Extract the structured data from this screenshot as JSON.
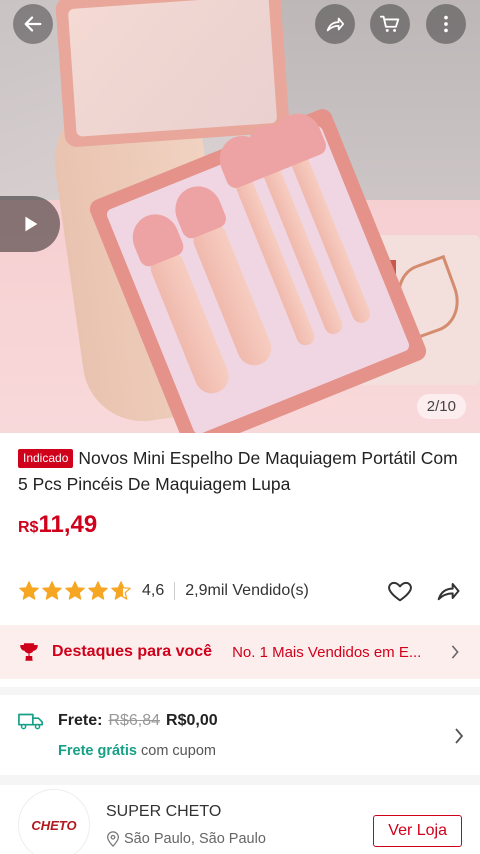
{
  "gallery": {
    "counter": "2/10",
    "icons": {
      "back": "arrow-left-icon",
      "share": "share-icon",
      "cart": "cart-icon",
      "more": "more-vertical-icon",
      "video": "play-icon"
    }
  },
  "product": {
    "tag": "Indicado",
    "title": "Novos Mini Espelho De Maquiagem Portátil Com 5 Pcs Pincéis De Maquiagem Lupa",
    "price_currency": "R$",
    "price_value": "11,49",
    "rating": "4,6",
    "stars": 4.6,
    "sold": "2,9mil Vendido(s)"
  },
  "highlights": {
    "title": "Destaques para você",
    "subtitle": "No. 1 Mais Vendidos em E..."
  },
  "shipping": {
    "label": "Frete:",
    "old_price": "R$6,84",
    "new_price": "R$0,00",
    "free_label": "Frete grátis",
    "free_suffix": "com cupom"
  },
  "store": {
    "logo_text": "CHETO",
    "name": "SUPER CHETO",
    "location": "São Paulo, São Paulo",
    "visit_label": "Ver Loja"
  },
  "colors": {
    "accent": "#d0011b",
    "free_shipping": "#16a085",
    "star": "#f6a623"
  }
}
